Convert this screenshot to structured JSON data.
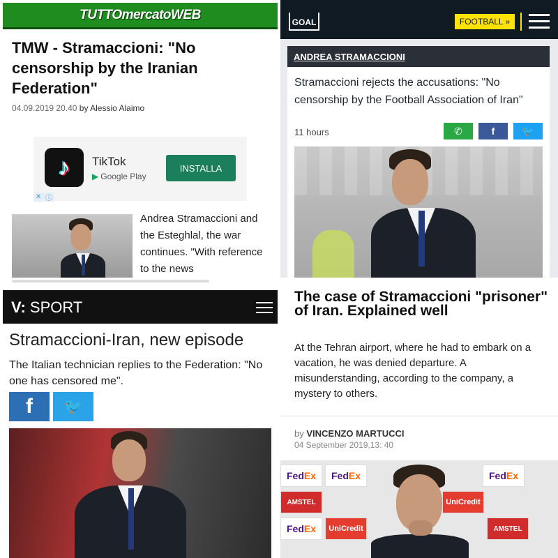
{
  "tmw": {
    "logo": "TUTTOmercatoWEB",
    "title": "TMW - Stramaccioni: \"No censorship by the Iranian Federation\"",
    "date": "04.09.2019 20.40",
    "by_prefix": "by",
    "author": "Alessio Alaimo",
    "ad": {
      "app_name": "TikTok",
      "store": "Google Play",
      "install_label": "INSTALLA",
      "adchoices_x": "✕",
      "adchoices_i": "ⓘ"
    },
    "related": "Andrea Stramaccioni and the Esteghlal, the war continues. \"With reference to the news"
  },
  "goal": {
    "logo": "GOAL",
    "section_button": "FOOTBALL »",
    "category": "ANDREA STRAMACCIONI",
    "title": "Stramaccioni rejects the accusations: \"No censorship by the Football Association of Iran\"",
    "time": "11 hours",
    "share": {
      "whatsapp": "✆",
      "facebook": "f",
      "twitter": "🐦"
    }
  },
  "vsport": {
    "logo_v": "V:",
    "logo_sport": "SPORT",
    "title": "Stramaccioni-Iran, new episode",
    "subtitle": "The Italian technician replies to the Federation: \"No one has censored me\".",
    "facebook": "f",
    "twitter": "🐦"
  },
  "article": {
    "title": "The case of Stramaccioni \"prisoner\" of Iran. Explained well",
    "lead": "At the Tehran airport, where he had to embark on a vacation, he was denied departure. A misunderstanding, according to the company, a mystery to others.",
    "by_prefix": "by",
    "author": "VINCENZO MARTUCCI",
    "date": "04 September 2019,13: 40",
    "backdrop": {
      "fedex_a": "Fed",
      "fedex_b": "Ex",
      "amstel": "AMSTEL",
      "unicredit": "UniCredit"
    }
  },
  "colors": {
    "tmw_green": "#1f8c1f",
    "goal_dark": "#0f1a22",
    "goal_yellow": "#ffe200",
    "facebook": "#3b5998",
    "twitter": "#1da1f2",
    "whatsapp": "#29a843"
  }
}
